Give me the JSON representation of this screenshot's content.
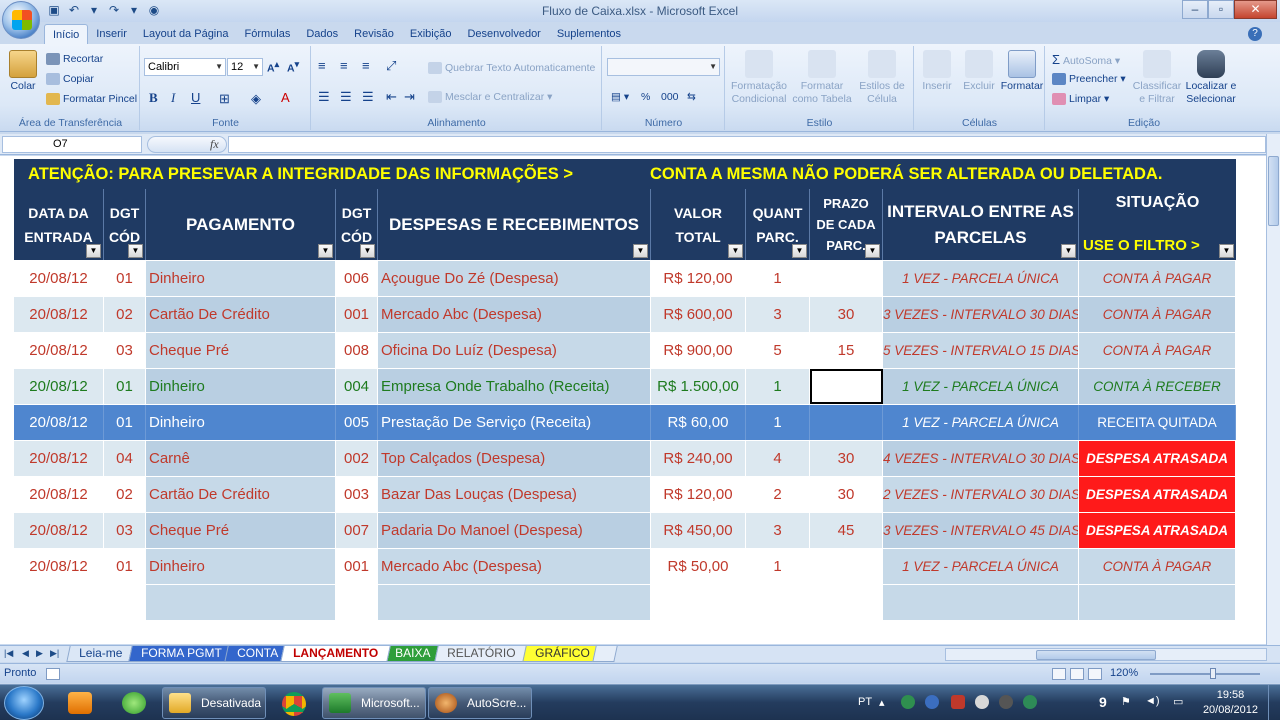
{
  "window": {
    "title": "Fluxo de Caixa.xlsx - Microsoft Excel"
  },
  "ribbon": {
    "tabs": [
      "Início",
      "Inserir",
      "Layout da Página",
      "Fórmulas",
      "Dados",
      "Revisão",
      "Exibição",
      "Desenvolvedor",
      "Suplementos"
    ],
    "clipboard": {
      "label": "Área de Transferência",
      "paste": "Colar",
      "cut": "Recortar",
      "copy": "Copiar",
      "format_painter": "Formatar Pincel"
    },
    "font": {
      "label": "Fonte",
      "family": "Calibri",
      "size": "12"
    },
    "alignment": {
      "label": "Alinhamento",
      "wrap_text": "Quebrar Texto Automaticamente",
      "merge_center": "Mesclar e Centralizar"
    },
    "number": {
      "label": "Número",
      "percent": "%"
    },
    "styles": {
      "label": "Estilo",
      "conditional": "Formatação Condicional",
      "table": "Formatar como Tabela",
      "cell_styles": "Estilos de Célula"
    },
    "cells": {
      "label": "Células",
      "insert": "Inserir",
      "delete": "Excluir",
      "format": "Formatar"
    },
    "editing": {
      "label": "Edição",
      "autosum": "AutoSoma",
      "fill": "Preencher",
      "clear": "Limpar",
      "sort": "Classificar e Filtrar",
      "find": "Localizar e Selecionar"
    }
  },
  "formula_bar": {
    "name_box": "O7",
    "fx": "fx",
    "value": ""
  },
  "sheet": {
    "banner_left": "ATENÇÃO: PARA PRESEVAR A INTEGRIDADE DAS INFORMAÇÕES >",
    "banner_right": "CONTA A MESMA NÃO PODERÁ SER ALTERADA OU DELETADA.",
    "headers": {
      "data": "DATA DA ENTRADA",
      "dgt1": "DGT CÓD",
      "pagamento": "PAGAMENTO",
      "dgt2": "DGT CÓD",
      "despesas": "DESPESAS E RECEBIMENTOS",
      "valor": "VALOR TOTAL",
      "quant": "QUANT PARC.",
      "prazo": "PRAZO DE CADA PARC.",
      "intervalo": "INTERVALO ENTRE AS PARCELAS",
      "situacao": "SITUAÇÃO",
      "filtro": "USE O FILTRO >"
    },
    "rows": [
      {
        "date": "20/08/12",
        "c1": "01",
        "pay": "Dinheiro",
        "c2": "006",
        "desc": "Açougue Do Zé (Despesa)",
        "value": "R$ 120,00",
        "qty": "1",
        "term": "",
        "interval": "1 VEZ - PARCELA ÚNICA",
        "status": "CONTA À PAGAR",
        "kind": "despesa",
        "status_kind": "pagar"
      },
      {
        "date": "20/08/12",
        "c1": "02",
        "pay": "Cartão De Crédito",
        "c2": "001",
        "desc": "Mercado Abc (Despesa)",
        "value": "R$ 600,00",
        "qty": "3",
        "term": "30",
        "interval": "3 VEZES - INTERVALO 30 DIAS",
        "status": "CONTA À PAGAR",
        "kind": "despesa",
        "status_kind": "pagar"
      },
      {
        "date": "20/08/12",
        "c1": "03",
        "pay": "Cheque Pré",
        "c2": "008",
        "desc": "Oficina Do Luíz (Despesa)",
        "value": "R$ 900,00",
        "qty": "5",
        "term": "15",
        "interval": "5 VEZES - INTERVALO 15 DIAS",
        "status": "CONTA À PAGAR",
        "kind": "despesa",
        "status_kind": "pagar"
      },
      {
        "date": "20/08/12",
        "c1": "01",
        "pay": "Dinheiro",
        "c2": "004",
        "desc": "Empresa Onde Trabalho (Receita)",
        "value": "R$ 1.500,00",
        "qty": "1",
        "term": "",
        "interval": "1 VEZ - PARCELA ÚNICA",
        "status": "CONTA À RECEBER",
        "kind": "receita",
        "status_kind": "receber"
      },
      {
        "date": "20/08/12",
        "c1": "01",
        "pay": "Dinheiro",
        "c2": "005",
        "desc": "Prestação De Serviço (Receita)",
        "value": "R$ 60,00",
        "qty": "1",
        "term": "",
        "interval": "1 VEZ - PARCELA ÚNICA",
        "status": "RECEITA QUITADA",
        "kind": "quitada",
        "status_kind": "quitada"
      },
      {
        "date": "20/08/12",
        "c1": "04",
        "pay": "Carnê",
        "c2": "002",
        "desc": "Top Calçados (Despesa)",
        "value": "R$ 240,00",
        "qty": "4",
        "term": "30",
        "interval": "4 VEZES - INTERVALO 30 DIAS",
        "status": "DESPESA ATRASADA",
        "kind": "despesa",
        "status_kind": "atrasada"
      },
      {
        "date": "20/08/12",
        "c1": "02",
        "pay": "Cartão De Crédito",
        "c2": "003",
        "desc": "Bazar Das Louças (Despesa)",
        "value": "R$ 120,00",
        "qty": "2",
        "term": "30",
        "interval": "2 VEZES - INTERVALO 30 DIAS",
        "status": "DESPESA ATRASADA",
        "kind": "despesa",
        "status_kind": "atrasada"
      },
      {
        "date": "20/08/12",
        "c1": "03",
        "pay": "Cheque Pré",
        "c2": "007",
        "desc": "Padaria Do Manoel (Despesa)",
        "value": "R$ 450,00",
        "qty": "3",
        "term": "45",
        "interval": "3 VEZES - INTERVALO 45 DIAS",
        "status": "DESPESA ATRASADA",
        "kind": "despesa",
        "status_kind": "atrasada"
      },
      {
        "date": "20/08/12",
        "c1": "01",
        "pay": "Dinheiro",
        "c2": "001",
        "desc": "Mercado Abc (Despesa)",
        "value": "R$ 50,00",
        "qty": "1",
        "term": "",
        "interval": "1 VEZ - PARCELA ÚNICA",
        "status": "CONTA À PAGAR",
        "kind": "despesa",
        "status_kind": "pagar"
      },
      {
        "date": "",
        "c1": "",
        "pay": "",
        "c2": "",
        "desc": "",
        "value": "",
        "qty": "",
        "term": "",
        "interval": "",
        "status": "",
        "kind": "empty",
        "status_kind": ""
      }
    ],
    "tabs": [
      {
        "label": "Leia-me",
        "color": "#dbe7f6",
        "text": "#15428b"
      },
      {
        "label": "FORMA PGMT",
        "color": "#3366cc",
        "text": "#ffffff"
      },
      {
        "label": "CONTA",
        "color": "#3366cc",
        "text": "#ffffff"
      },
      {
        "label": "LANÇAMENTO",
        "color": "#ffffff",
        "text": "#c00000",
        "active": true
      },
      {
        "label": "BAIXA",
        "color": "#2e9e3a",
        "text": "#ffffff"
      },
      {
        "label": "RELATÓRIO",
        "color": "#e6eef9",
        "text": "#555555"
      },
      {
        "label": "GRÁFICO",
        "color": "#ffff33",
        "text": "#333333"
      }
    ]
  },
  "colors": {
    "header_bg": "#1f3a63",
    "banner_text": "#ffff00",
    "despesa_text": "#c0392b",
    "receita_text": "#1e7b1e",
    "selected_row": "#4f86cf",
    "atrasada_bg": "#ff1a1a",
    "row_light": "#ffffff",
    "row_alt": "#dce8f0",
    "col_shade": "#c6d9e8"
  },
  "status_bar": {
    "ready": "Pronto",
    "zoom": "120%"
  },
  "taskbar": {
    "tasks": [
      "Desativada",
      "Microsoft...",
      "AutoScre..."
    ],
    "lang": "PT",
    "tray_number": "9",
    "time": "19:58",
    "date": "20/08/2012"
  }
}
